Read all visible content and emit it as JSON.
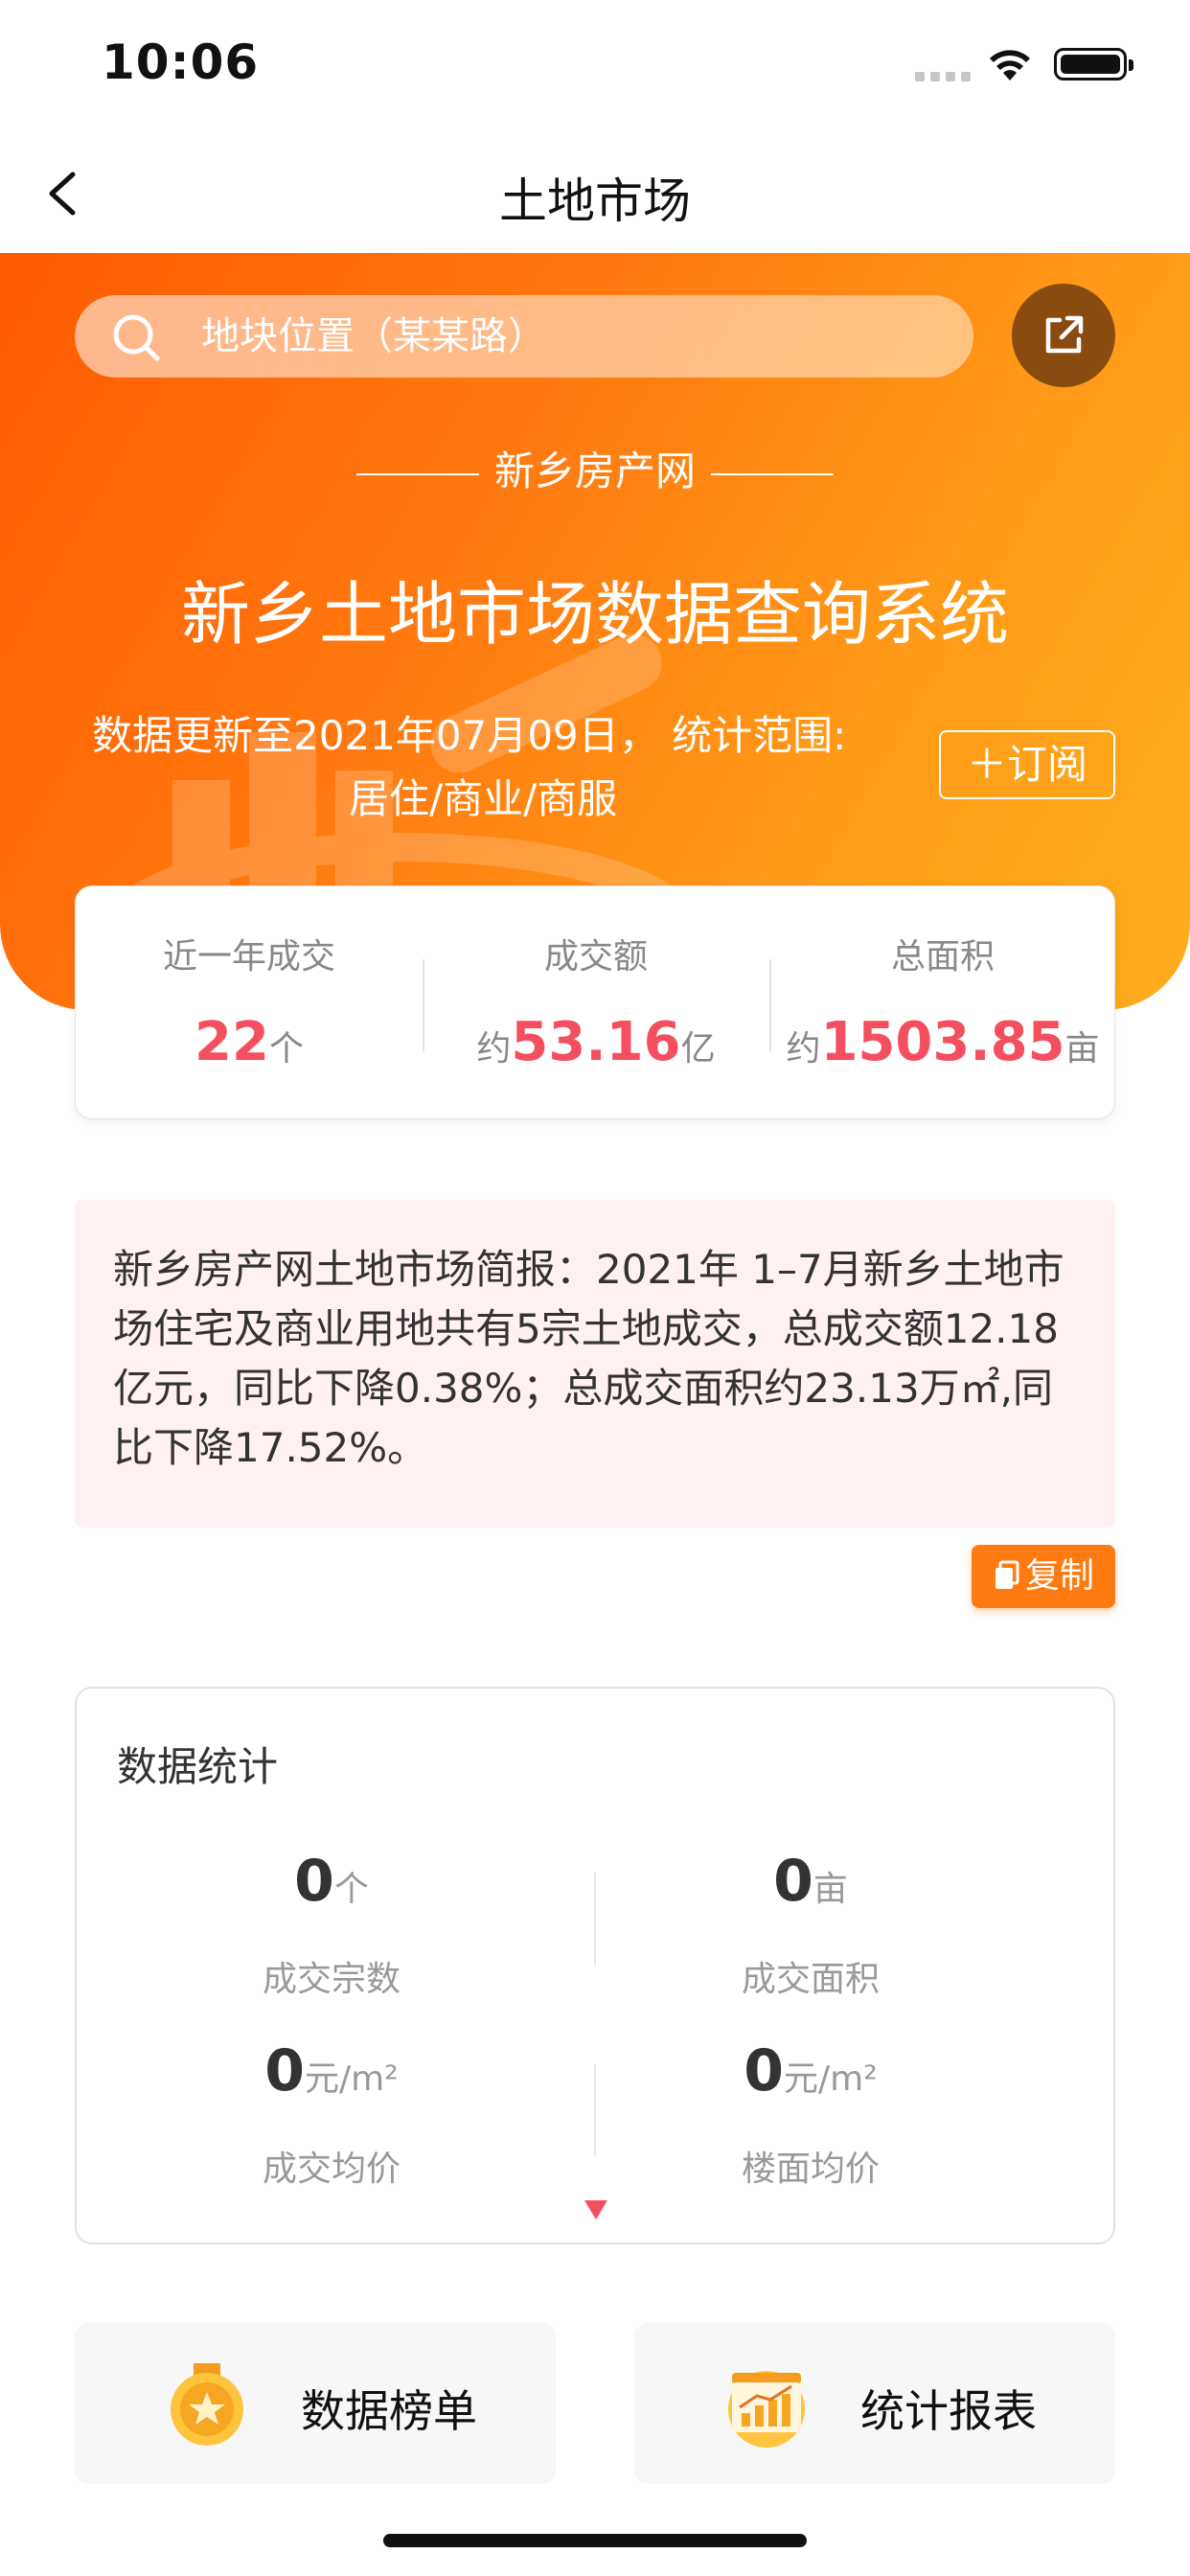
{
  "status_bar": {
    "time": "10:06"
  },
  "nav": {
    "title": "土地市场"
  },
  "search": {
    "placeholder": "地块位置（某某路）"
  },
  "hero": {
    "subtitle": "新乡房产网",
    "title": "新乡土地市场数据查询系统",
    "update_line": "数据更新至2021年07月09日， 统计范围:",
    "scope": "居住/商业/商服",
    "subscribe_label": "＋订阅"
  },
  "summary": [
    {
      "label": "近一年成交",
      "prefix": "",
      "value": "22",
      "unit": "个"
    },
    {
      "label": "成交额",
      "prefix": "约",
      "value": "53.16",
      "unit": "亿"
    },
    {
      "label": "总面积",
      "prefix": "约",
      "value": "1503.85",
      "unit": "亩"
    }
  ],
  "report": {
    "text": "新乡房产网土地市场简报：2021年 1–7月新乡土地市场住宅及商业用地共有5宗土地成交，总成交额12.18亿元，同比下降0.38%；总成交面积约23.13万㎡,同比下降17.52%。",
    "copy_label": "复制"
  },
  "stats": {
    "title": "数据统计",
    "items": [
      {
        "value": "0",
        "unit": "个",
        "label": "成交宗数"
      },
      {
        "value": "0",
        "unit": "亩",
        "label": "成交面积"
      },
      {
        "value": "0",
        "unit": "元/m²",
        "label": "成交均价"
      },
      {
        "value": "0",
        "unit": "元/m²",
        "label": "楼面均价"
      }
    ]
  },
  "tools": [
    {
      "label": "数据榜单",
      "icon": "medal-icon"
    },
    {
      "label": "统计报表",
      "icon": "bar-chart-icon"
    }
  ],
  "colors": {
    "accent": "#ff7a10",
    "highlight": "#f44f5f",
    "share_bg": "#8a4b10"
  }
}
